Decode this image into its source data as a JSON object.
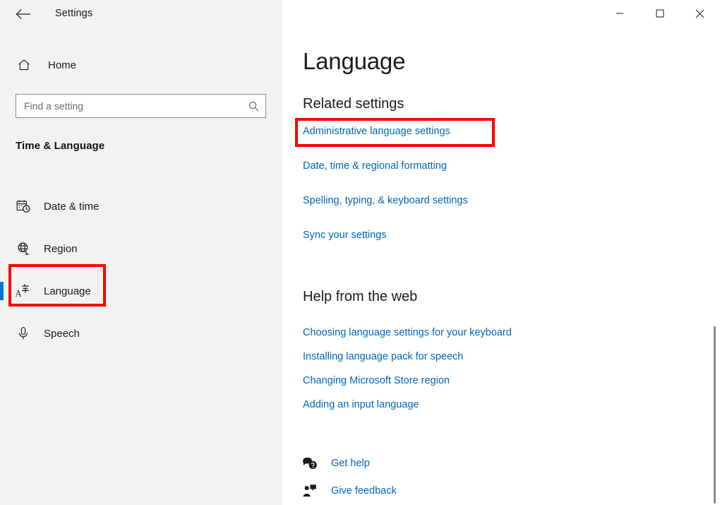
{
  "titlebar": {
    "back_icon": "back-arrow-icon",
    "app_title": "Settings",
    "minimize_label": "—",
    "maximize_label": "□",
    "close_label": "✕"
  },
  "sidebar": {
    "home": {
      "label": "Home",
      "icon": "home-icon"
    },
    "search": {
      "placeholder": "Find a setting",
      "value": "",
      "icon": "search-icon"
    },
    "section_title": "Time & Language",
    "items": [
      {
        "label": "Date & time",
        "icon": "calendar-clock-icon",
        "selected": false
      },
      {
        "label": "Region",
        "icon": "globe-icon",
        "selected": false
      },
      {
        "label": "Language",
        "icon": "language-characters-icon",
        "selected": true
      },
      {
        "label": "Speech",
        "icon": "microphone-icon",
        "selected": false
      }
    ]
  },
  "main": {
    "page_title": "Language",
    "related_settings": {
      "heading": "Related settings",
      "links": [
        "Administrative language settings",
        "Date, time & regional formatting",
        "Spelling, typing, & keyboard settings",
        "Sync your settings"
      ]
    },
    "help_from_web": {
      "heading": "Help from the web",
      "links": [
        "Choosing language settings for your keyboard",
        "Installing language pack for speech",
        "Changing Microsoft Store region",
        "Adding an input language"
      ]
    },
    "footer_links": [
      {
        "label": "Get help",
        "icon": "help-bubble-icon"
      },
      {
        "label": "Give feedback",
        "icon": "feedback-person-icon"
      }
    ]
  },
  "annotations": [
    {
      "name": "language-sidebar-highlight",
      "color": "#ff0000"
    },
    {
      "name": "administrative-language-settings-highlight",
      "color": "#ff0000"
    }
  ],
  "colors": {
    "link": "#0067b8",
    "accent": "#0078d4",
    "sidebar_bg": "#f2f2f2",
    "annotation": "#ff0000",
    "text": "#1b1b1b"
  }
}
